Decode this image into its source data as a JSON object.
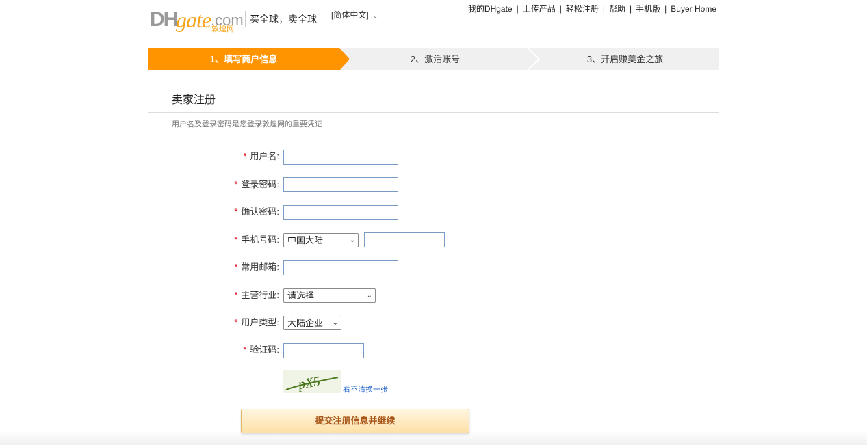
{
  "header": {
    "logo": {
      "dh": "DH",
      "gate": "gate",
      "com": ".com",
      "cn": "敦煌网"
    },
    "slogan": "买全球，卖全球",
    "language": "[简体中文]",
    "links": [
      "我的DHgate",
      "上传产品",
      "轻松注册",
      "帮助",
      "手机版",
      "Buyer Home"
    ],
    "separator": "|"
  },
  "steps": [
    {
      "label": "1、填写商户信息",
      "active": true
    },
    {
      "label": "2、激活账号",
      "active": false
    },
    {
      "label": "3、开启赚美金之旅",
      "active": false
    }
  ],
  "colors": {
    "step_active": "#ff9400",
    "step_inactive": "#f0f0f0",
    "required_star": "#d6000f",
    "link": "#1a5fc7"
  },
  "form": {
    "title": "卖家注册",
    "subtitle": "用户名及登录密码是您登录敦煌网的重要凭证",
    "required_mark": "*",
    "fields": {
      "username": {
        "label": "用户名:",
        "value": ""
      },
      "password": {
        "label": "登录密码:",
        "value": ""
      },
      "confirm_password": {
        "label": "确认密码:",
        "value": ""
      },
      "phone": {
        "label": "手机号码:",
        "region": "中国大陆",
        "value": ""
      },
      "email": {
        "label": "常用邮箱:",
        "value": ""
      },
      "industry": {
        "label": "主营行业:",
        "selected": "请选择"
      },
      "user_type": {
        "label": "用户类型:",
        "selected": "大陆企业"
      },
      "captcha": {
        "label": "验证码:",
        "value": "",
        "image_text": "pX5",
        "refresh_link": "看不清换一张"
      }
    },
    "submit_label": "提交注册信息并继续"
  }
}
